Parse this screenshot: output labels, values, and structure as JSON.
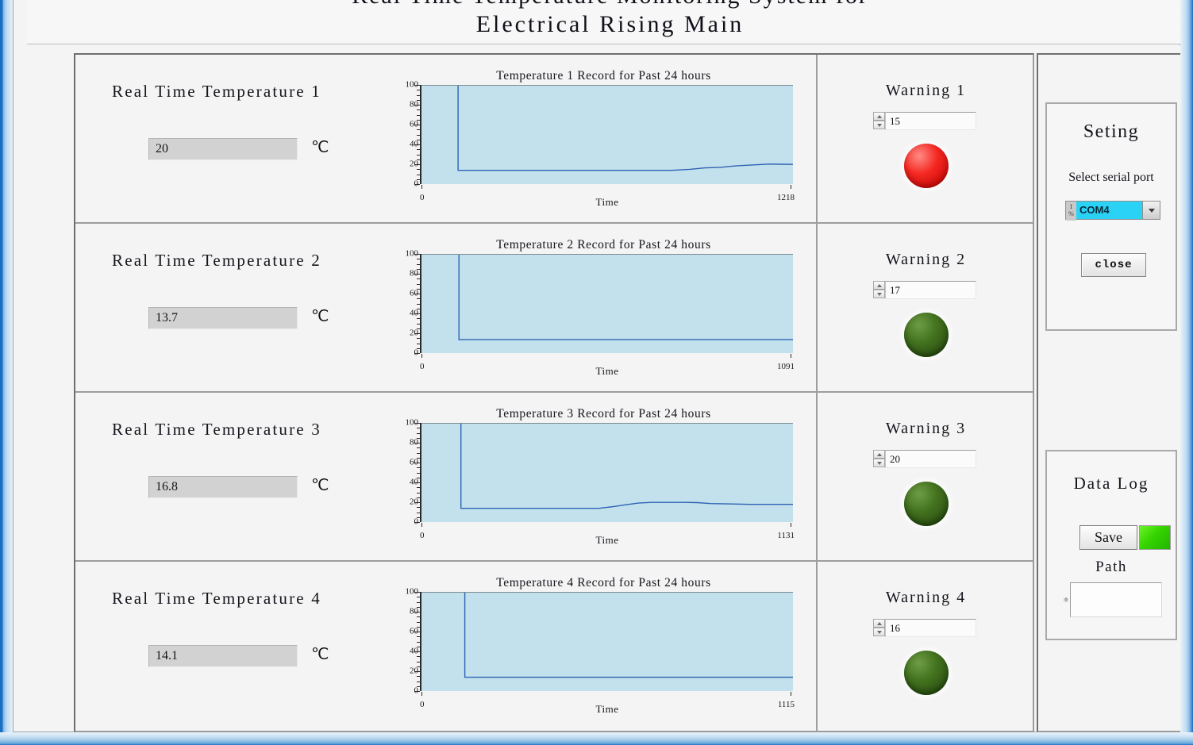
{
  "window": {
    "title_line_1": "Real Time Temperature Monitoring System for",
    "title_line_2": "Electrical Rising Main"
  },
  "panels": [
    {
      "rt_label": "Real Time Temperature 1",
      "rt_value": "20",
      "rt_unit": "℃",
      "chart_title": "Temperature 1 Record for Past 24 hours",
      "x_min": "0",
      "x_max": "1218",
      "x_axis_label": "Time",
      "warning_title": "Warning 1",
      "warning_threshold": "15",
      "led_state": "on"
    },
    {
      "rt_label": "Real Time Temperature 2",
      "rt_value": "13.7",
      "rt_unit": "℃",
      "chart_title": "Temperature 2 Record for Past 24 hours",
      "x_min": "0",
      "x_max": "1091",
      "x_axis_label": "Time",
      "warning_title": "Warning 2",
      "warning_threshold": "17",
      "led_state": "off"
    },
    {
      "rt_label": "Real Time Temperature 3",
      "rt_value": "16.8",
      "rt_unit": "℃",
      "chart_title": "Temperature 3 Record for Past 24 hours",
      "x_min": "0",
      "x_max": "1131",
      "x_axis_label": "Time",
      "warning_title": "Warning 3",
      "warning_threshold": "20",
      "led_state": "off"
    },
    {
      "rt_label": "Real Time Temperature 4",
      "rt_value": "14.1",
      "rt_unit": "℃",
      "chart_title": "Temperature 4 Record for Past 24 hours",
      "x_min": "0",
      "x_max": "1115",
      "x_axis_label": "Time",
      "warning_title": "Warning 4",
      "warning_threshold": "16",
      "led_state": "off"
    }
  ],
  "y_ticks": [
    "100",
    "80",
    "60",
    "40",
    "20",
    "0"
  ],
  "setting": {
    "title": "Seting",
    "select_serial_port_label": "Select serial port",
    "serial_port_value": "COM4",
    "serial_port_icon": "string-io-icon",
    "dropdown_icon": "chevron-down-icon",
    "close_label": "close"
  },
  "data_log": {
    "title": "Data Log",
    "save_label": "Save",
    "save_indicator_state": "on",
    "path_label": "Path",
    "path_value": "",
    "path_icon": "folder-icon"
  },
  "colors": {
    "plot_background": "#c3e1ec",
    "plot_line": "#2f62b4",
    "led_on": "#f52822",
    "led_off": "#2e5414",
    "save_indicator": "#35d400",
    "combo_highlight": "#2ad2f5",
    "window_border": "#1a6fc4"
  },
  "chart_data": [
    {
      "type": "line",
      "title": "Temperature 1 Record for Past 24 hours",
      "xlabel": "Time",
      "ylabel": "",
      "xlim": [
        0,
        1218
      ],
      "ylim": [
        0,
        100
      ],
      "yticks": [
        0,
        20,
        40,
        60,
        80,
        100
      ],
      "xticks": [
        0,
        1218
      ],
      "grid": false,
      "legend": "none",
      "series": [
        {
          "name": "Temperature 1",
          "x": [
            120,
            120,
            140,
            820,
            880,
            930,
            980,
            1030,
            1090,
            1140,
            1180,
            1218
          ],
          "y": [
            100,
            14,
            14,
            14,
            15,
            16.5,
            17,
            18.5,
            19.5,
            20.3,
            20.2,
            20
          ]
        }
      ]
    },
    {
      "type": "line",
      "title": "Temperature 2 Record for Past 24 hours",
      "xlabel": "Time",
      "ylabel": "",
      "xlim": [
        0,
        1091
      ],
      "ylim": [
        0,
        100
      ],
      "yticks": [
        0,
        20,
        40,
        60,
        80,
        100
      ],
      "xticks": [
        0,
        1091
      ],
      "grid": false,
      "legend": "none",
      "series": [
        {
          "name": "Temperature 2",
          "x": [
            110,
            110,
            130,
            1091
          ],
          "y": [
            100,
            13.7,
            13.7,
            13.7
          ]
        }
      ]
    },
    {
      "type": "line",
      "title": "Temperature 3 Record for Past 24 hours",
      "xlabel": "Time",
      "ylabel": "",
      "xlim": [
        0,
        1131
      ],
      "ylim": [
        0,
        100
      ],
      "yticks": [
        0,
        20,
        40,
        60,
        80,
        100
      ],
      "xticks": [
        0,
        1131
      ],
      "grid": false,
      "legend": "none",
      "series": [
        {
          "name": "Temperature 3",
          "x": [
            120,
            120,
            140,
            540,
            580,
            620,
            660,
            700,
            760,
            800,
            840,
            880,
            930,
            1000,
            1131
          ],
          "y": [
            100,
            14,
            14,
            14,
            15.5,
            17.5,
            19.3,
            20,
            20,
            20,
            19.8,
            18.8,
            18.5,
            18,
            18
          ]
        }
      ]
    },
    {
      "type": "line",
      "title": "Temperature 4 Record for Past 24 hours",
      "xlabel": "Time",
      "ylabel": "",
      "xlim": [
        0,
        1115
      ],
      "ylim": [
        0,
        100
      ],
      "yticks": [
        0,
        20,
        40,
        60,
        80,
        100
      ],
      "xticks": [
        0,
        1115
      ],
      "grid": false,
      "legend": "none",
      "series": [
        {
          "name": "Temperature 4",
          "x": [
            130,
            130,
            150,
            1115
          ],
          "y": [
            100,
            14.1,
            14.1,
            14.1
          ]
        }
      ]
    }
  ]
}
